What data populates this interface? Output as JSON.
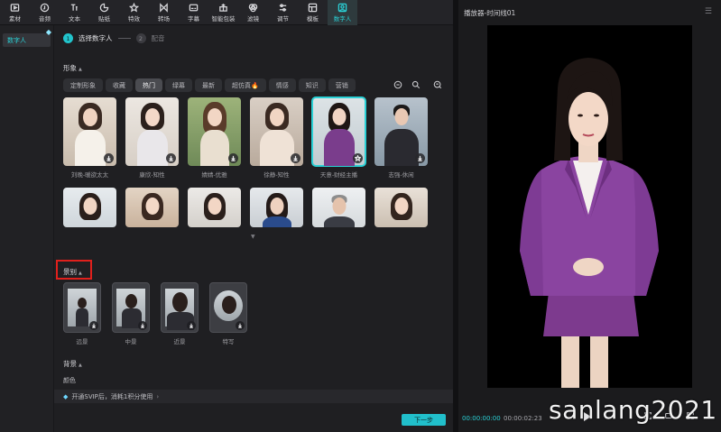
{
  "toolbar": {
    "tools": [
      {
        "label": "素材",
        "icon": "media-icon"
      },
      {
        "label": "音频",
        "icon": "audio-icon"
      },
      {
        "label": "文本",
        "icon": "text-icon"
      },
      {
        "label": "贴纸",
        "icon": "sticker-icon"
      },
      {
        "label": "特效",
        "icon": "effects-icon"
      },
      {
        "label": "转场",
        "icon": "transition-icon"
      },
      {
        "label": "字幕",
        "icon": "subtitle-icon"
      },
      {
        "label": "智能包装",
        "icon": "smart-pack-icon"
      },
      {
        "label": "滤镜",
        "icon": "filter-icon"
      },
      {
        "label": "调节",
        "icon": "adjust-icon"
      },
      {
        "label": "模板",
        "icon": "template-icon"
      },
      {
        "label": "数字人",
        "icon": "digital-human-icon"
      }
    ],
    "active": "数字人",
    "accent": "#2ad1d6"
  },
  "sidebar": {
    "items": [
      {
        "label": "数字人",
        "badge": "💎"
      }
    ]
  },
  "steps": {
    "step1": {
      "num": "1",
      "label": "选择数字人"
    },
    "step2": {
      "num": "2",
      "label": "配音"
    }
  },
  "sections": {
    "avatar": "形象",
    "scene": "景别",
    "background": "背景",
    "color": "颜色"
  },
  "chips": [
    "定制形象",
    "收藏",
    "热门",
    "绿幕",
    "最新",
    "超仿真🔥",
    "情感",
    "知识",
    "营销"
  ],
  "selected_chip": "热门",
  "avatars_row1": [
    "刘晚-暖欲太太",
    "康欣-知性",
    "婧婧-优雅",
    "徐静-知性",
    "天意-财经主播",
    "志强-休闲"
  ],
  "selected_avatar": "天意-财经主播",
  "scenes": [
    "远景",
    "中景",
    "近景",
    "特写"
  ],
  "vip_text": "开通SVIP后，消耗1积分使用",
  "next_button": "下一步",
  "player": {
    "title": "播放器-时间线01",
    "current_time": "00:00:00:00",
    "total_time": "00:00:02:23"
  },
  "watermark": "sanlang2021"
}
